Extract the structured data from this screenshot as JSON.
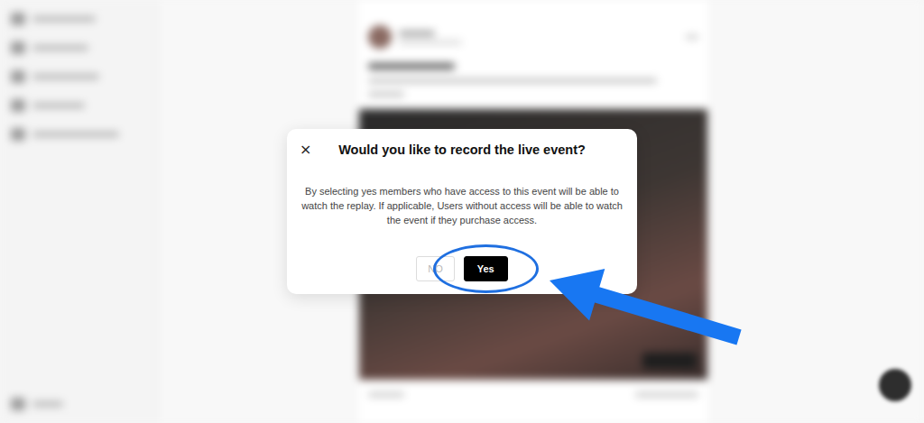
{
  "modal": {
    "title": "Would you like to record the live event?",
    "close": "×",
    "body": "By selecting yes members who have access to this event will be able to watch the replay. If applicable, Users without access will be able to watch the event if they purchase access.",
    "buttons": [
      {
        "label": "NO",
        "kind": "secondary",
        "highlighted": false
      },
      {
        "label": "Yes",
        "kind": "primary",
        "highlighted": true
      }
    ]
  }
}
